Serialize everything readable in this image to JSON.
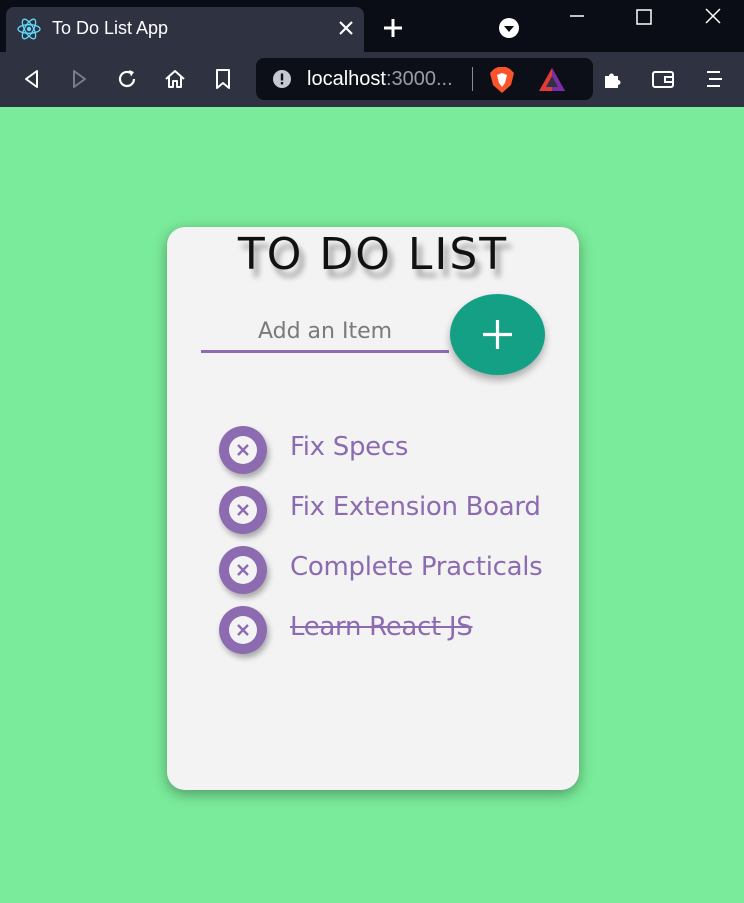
{
  "browser": {
    "tab": {
      "title": "To Do List App"
    },
    "url": {
      "host": "localhost",
      "rest": ":3000..."
    }
  },
  "app": {
    "title": "TO DO LIST",
    "input": {
      "placeholder": "Add an Item",
      "value": ""
    },
    "add_button": {
      "icon": "plus-icon",
      "color": "#14a085"
    },
    "accent_color": "#8c6bb1",
    "items": [
      {
        "text": "Fix Specs",
        "completed": false
      },
      {
        "text": "Fix Extension Board",
        "completed": false
      },
      {
        "text": "Complete Practicals",
        "completed": false
      },
      {
        "text": "Learn React JS",
        "completed": true
      }
    ]
  }
}
